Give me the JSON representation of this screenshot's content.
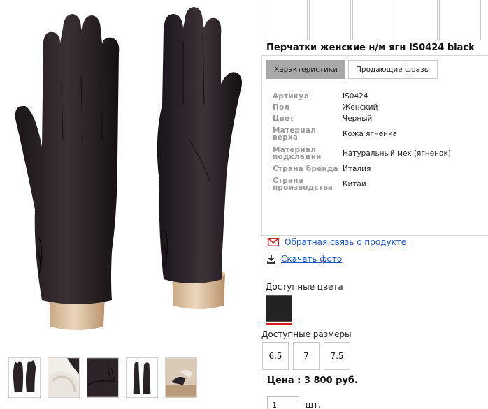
{
  "product": {
    "title": "Перчатки женские н/м ягн IS0424 black"
  },
  "tabs": [
    {
      "label": "Характеристики",
      "active": true
    },
    {
      "label": "Продающие фразы",
      "active": false
    }
  ],
  "specs": [
    {
      "label": "Артикул",
      "value": "IS0424"
    },
    {
      "label": "Пол",
      "value": "Женский"
    },
    {
      "label": "Цвет",
      "value": "Черный"
    },
    {
      "label": "Материал верха",
      "value": "Кожа ягненка"
    },
    {
      "label": "Материал подкладки",
      "value": "Натуральный мех (ягненок)"
    },
    {
      "label": "Страна бренда",
      "value": "Италия"
    },
    {
      "label": "Страна производства",
      "value": "Китай"
    }
  ],
  "links": {
    "feedback": "Обратная связь о продукте",
    "download_photo": "Скачать фото"
  },
  "colors": {
    "label": "Доступные цвета",
    "swatch_color": "#232225",
    "selected_underline": "#d42020"
  },
  "sizes": {
    "label": "Доступные размеры",
    "options": [
      "6.5",
      "7",
      "7.5"
    ]
  },
  "price": {
    "text": "Цена : 3 800 руб."
  },
  "quantity": {
    "value": "1",
    "unit": "шт."
  },
  "icons": {
    "feedback": "envelope-icon",
    "download": "download-icon"
  }
}
